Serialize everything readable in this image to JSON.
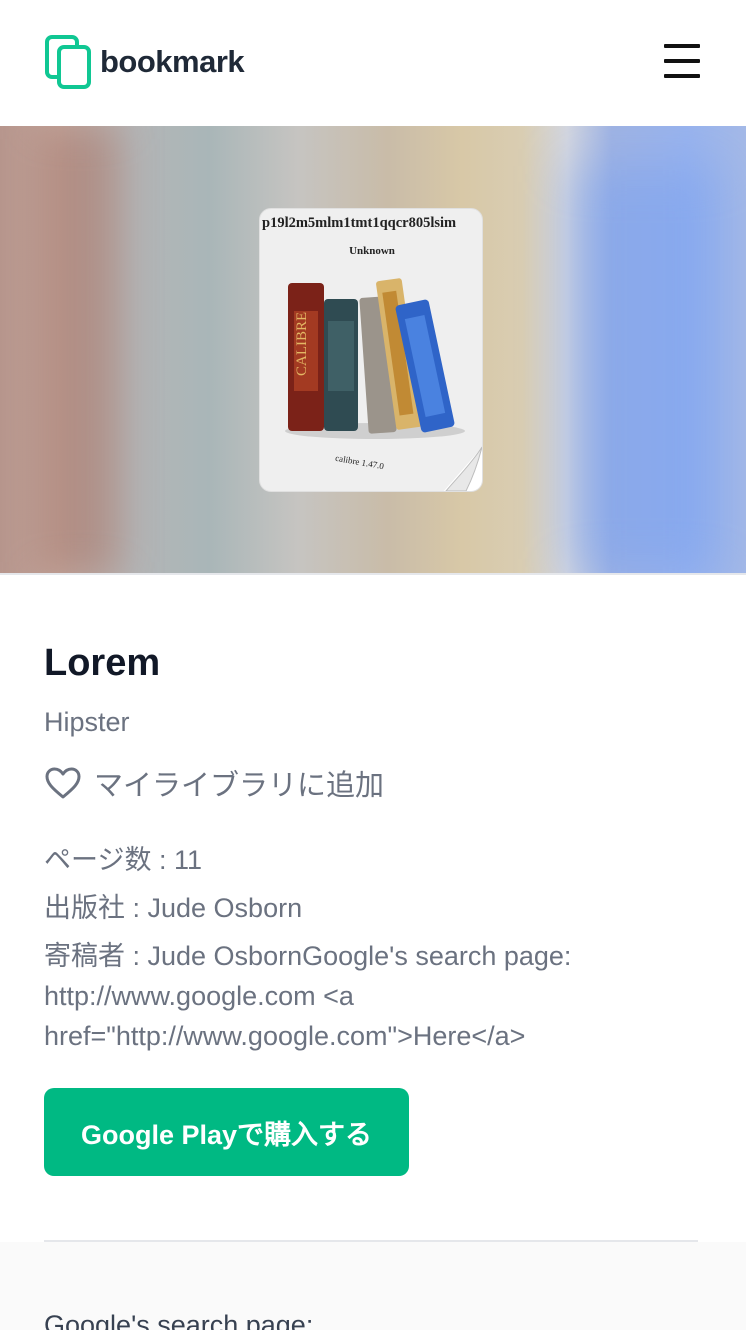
{
  "header": {
    "logo_text": "bookmark",
    "brand_color": "#10c793",
    "menu_icon": "hamburger-icon"
  },
  "cover": {
    "title": "p19l2m5mlm1tmt1qqcr805lsim",
    "author": "Unknown",
    "stamp": "calibre 1.47.0"
  },
  "book": {
    "title": "Lorem",
    "subtitle": "Hipster",
    "add_library_label": "マイライブラリに追加",
    "pages": "ページ数 : 11",
    "publisher": "出版社 : Jude Osborn",
    "contributor": "寄稿者 : Jude OsbornGoogle's search page: http://www.google.com <a href=\"http://www.google.com\">Here</a>",
    "buy_label": "Google Playで購入する"
  },
  "description": {
    "text": "Google's search page:"
  },
  "colors": {
    "accent": "#00b983",
    "muted_text": "#6b7280",
    "heading": "#111827"
  }
}
